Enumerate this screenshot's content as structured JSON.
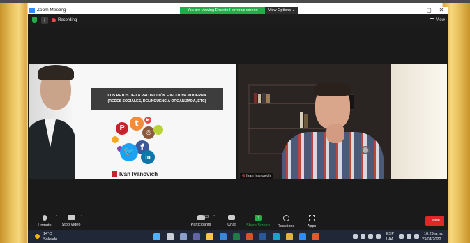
{
  "window": {
    "title": "Zoom Meeting",
    "share_banner": "You are viewing Ernesto Herrera's screen",
    "view_options": "View Options ⌄"
  },
  "status_bar": {
    "info_symbol": "i",
    "recording_label": "Recording",
    "view_label": "View"
  },
  "shared_slide": {
    "title_line1": "LOS RETOS DE LA PROTECCIÓN EJECUTIVA MODERNA",
    "title_line2": "(REDES SOCIALES, DELINCUENCIA ORGANIZADA, ETC)",
    "brand_name": "Ivan Ivanovich",
    "social_icons": [
      "pinterest-icon",
      "tumblr-icon",
      "youtube-icon",
      "instagram-icon",
      "facebook-icon",
      "twitter-icon",
      "linkedin-icon"
    ],
    "glyphs": {
      "pinterest": "P",
      "tumblr": "t",
      "youtube": "▶",
      "instagram": "◎",
      "facebook": "f",
      "twitter": "🐦",
      "linkedin": "in"
    }
  },
  "camera": {
    "participant_name": "Ivan Ivanovich"
  },
  "toolbar": {
    "unmute_label": "Unmute",
    "stop_video_label": "Stop Video",
    "participants_label": "Participants",
    "participants_count": "83",
    "chat_label": "Chat",
    "share_screen_label": "Share Screen",
    "share_glyph": "↑",
    "reactions_label": "Reactions",
    "apps_label": "Apps",
    "leave_label": "Leave",
    "caret": "^"
  },
  "taskbar": {
    "temperature": "14°C",
    "condition": "Soleado",
    "lang_line1": "ESP",
    "lang_line2": "LAA",
    "time": "10:29 a. m.",
    "date": "23/04/2022"
  },
  "colors": {
    "accent_green": "#1fae4a",
    "leave_red": "#e02828",
    "zoom_blue": "#2d8cff"
  }
}
